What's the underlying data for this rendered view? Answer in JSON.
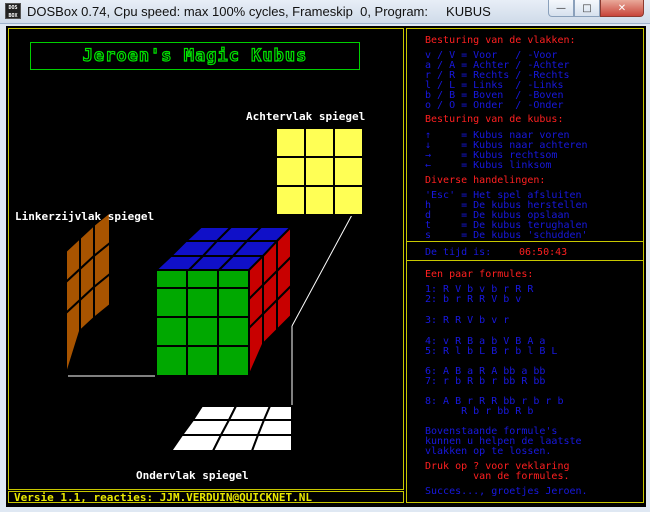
{
  "window": {
    "title": "DOSBox 0.74, Cpu speed: max 100% cycles, Frameskip  0, Program:     KUBUS",
    "icon_label": "DOS BOX",
    "buttons": {
      "minimize": "—",
      "maximize": "□",
      "close": "✕"
    }
  },
  "game": {
    "logo": "Jeroen's Magic Kubus",
    "labels": {
      "back": "Achtervlak spiegel",
      "left": "Linkerzijvlak spiegel",
      "bottom": "Ondervlak spiegel"
    },
    "footer": "Versie 1.1, reacties: JJM.VERDUIN@QUICKNET.NL",
    "colors": {
      "top": "#1010c8",
      "front": "#00a800",
      "right": "#c80000",
      "back_mirror": "#ffff55",
      "left_mirror": "#a85400",
      "bottom_mirror": "#ffffff"
    }
  },
  "help": {
    "planes_title": "Besturing van de vlakken:",
    "planes": [
      "v / V = Voor   / -Voor",
      "a / A = Achter / -Achter",
      "r / R = Rechts / -Rechts",
      "l / L = Links  / -Links",
      "b / B = Boven  / -Boven",
      "o / O = Onder  / -Onder"
    ],
    "cube_title": "Besturing van de kubus:",
    "cube": [
      "↑     = Kubus naar voren",
      "↓     = Kubus naar achteren",
      "→     = Kubus rechtsom",
      "←     = Kubus linksom"
    ],
    "misc_title": "Diverse handelingen:",
    "misc": [
      "'Esc' = Het spel afsluiten",
      "h     = De kubus herstellen",
      "d     = De kubus opslaan",
      "t     = De kubus terughalen",
      "s     = De kubus 'schudden'"
    ],
    "time_label": "De tijd is:",
    "time_value": "06:50:43",
    "formulas_title": "Een paar formules:",
    "formulas": [
      "1: R V b v b r R R",
      "2: b r R R V b v",
      "3: R R V b v r",
      "4: v R B a b V B A a",
      "5: R l b L B r b l B L",
      "6: A B a R A bb a bb",
      "7: r b R b r bb R bb",
      "8: A B r R R bb r b r b",
      "      R b r bb R b"
    ],
    "note": [
      "Bovenstaande formule's",
      "kunnen u helpen de laatste",
      "vlakken op te lossen."
    ],
    "press": [
      "Druk op ? voor veklaring",
      "        van de formules."
    ],
    "bye": "Succes..., groetjes Jeroen."
  }
}
